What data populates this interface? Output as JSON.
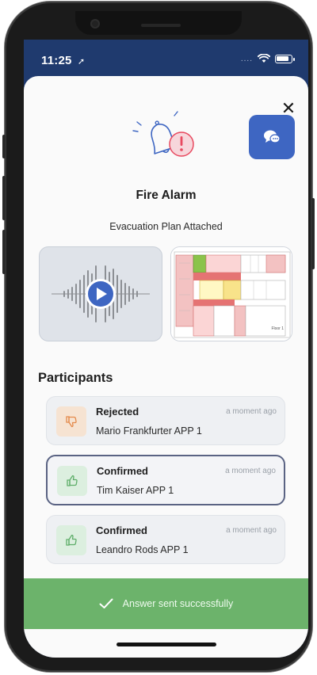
{
  "status_bar": {
    "time": "11:25",
    "location_glyph": "➚",
    "signal_dots": "...."
  },
  "alert": {
    "title": "Fire Alarm",
    "attachment_label": "Evacuation Plan Attached",
    "close_glyph": "✕",
    "icon": "bell-warning-icon"
  },
  "floor_plan": {
    "floor_label": "Floor 1"
  },
  "participants": {
    "title": "Participants",
    "items": [
      {
        "status": "Rejected",
        "name": "Mario Frankfurter APP 1",
        "time": "a moment ago",
        "icon": "thumbs-down-icon"
      },
      {
        "status": "Confirmed",
        "name": "Tim Kaiser APP 1",
        "time": "a moment ago",
        "icon": "thumbs-up-icon"
      },
      {
        "status": "Confirmed",
        "name": "Leandro Rods APP 1",
        "time": "a moment ago",
        "icon": "thumbs-up-icon"
      }
    ]
  },
  "toast": {
    "message": "Answer sent successfully",
    "icon": "checkmark-icon"
  },
  "colors": {
    "header_blue": "#1f3a6e",
    "accent_blue": "#3e66c2",
    "success_green": "#6cb36b",
    "rejected_orange": "#f6e3d2",
    "confirmed_green": "#dcefdf",
    "alert_red": "#e8495f"
  }
}
